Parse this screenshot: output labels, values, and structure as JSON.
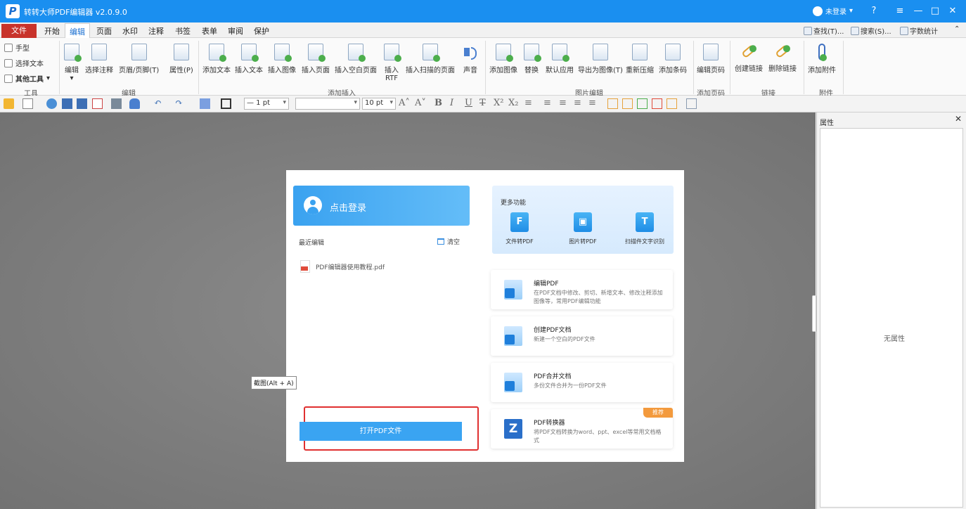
{
  "titlebar": {
    "logo": "P",
    "title": "转转大师PDF编辑器 v2.0.9.0",
    "user_label": "未登录",
    "user_caret": "▾",
    "controls": {
      "help": "?",
      "menu": "≡",
      "minimize": "—",
      "maximize": "□",
      "close": "✕"
    }
  },
  "menubar": {
    "file_tab": "文件",
    "tabs": [
      "开始",
      "编辑",
      "页面",
      "水印",
      "注释",
      "书签",
      "表单",
      "审阅",
      "保护"
    ],
    "active_tab": "编辑",
    "right_tools": [
      "查找(T)...",
      "搜索(S)...",
      "字数统计"
    ],
    "collapse": "⌃"
  },
  "ribbon": {
    "left_tools": [
      "手型",
      "选择文本",
      "其他工具"
    ],
    "buttons": [
      {
        "label": "编辑",
        "sub": "▾"
      },
      {
        "label": "选择注释"
      },
      {
        "label": "页眉/页脚(T)"
      },
      {
        "label": "属性(P)"
      },
      {
        "label": "添加文本"
      },
      {
        "label": "插入文本"
      },
      {
        "label": "插入图像"
      },
      {
        "label": "插入页面"
      },
      {
        "label": "插入空白页面"
      },
      {
        "label": "插入",
        "sub": "RTF"
      },
      {
        "label": "插入扫描的页面"
      },
      {
        "label": "声音"
      },
      {
        "label": "添加图像"
      },
      {
        "label": "替换"
      },
      {
        "label": "默认应用"
      },
      {
        "label": "导出为图像(T)"
      },
      {
        "label": "重新压缩"
      },
      {
        "label": "添加条码"
      },
      {
        "label": "编辑页码"
      },
      {
        "label": "创建链接"
      },
      {
        "label": "删除链接"
      },
      {
        "label": "添加附件"
      }
    ],
    "groups": [
      "工具",
      "编辑",
      "添加插入",
      "图片编辑",
      "添加页码",
      "链接",
      "附件"
    ]
  },
  "toolbar2": {
    "line_width": "— 1 pt",
    "font_name": "",
    "font_size": "10 pt",
    "text_buttons": [
      "A˄",
      "A˅",
      "B",
      "I",
      "U",
      "T",
      "X²",
      "X₂"
    ]
  },
  "start_panel": {
    "login_label": "点击登录",
    "recent_label": "最近编辑",
    "clear_label": "清空",
    "recent_files": [
      "PDF编辑器使用教程.pdf"
    ],
    "open_button": "打开PDF文件",
    "more_title": "更多功能",
    "features": [
      {
        "label": "文件转PDF",
        "glyph": "F"
      },
      {
        "label": "图片转PDF",
        "glyph": "▣"
      },
      {
        "label": "扫描件文字识别",
        "glyph": "T"
      }
    ],
    "cards": [
      {
        "title": "编辑PDF",
        "desc": "在PDF文档中修改、剪切、新增文本、修改注释添加图像等，常用PDF编辑功能"
      },
      {
        "title": "创建PDF文档",
        "desc": "新建一个空白的PDF文件"
      },
      {
        "title": "PDF合并文档",
        "desc": "多份文件合并为一份PDF文件"
      },
      {
        "title": "PDF转换器",
        "desc": "将PDF文档转换为word、ppt、excel等常用文档格式",
        "badge": "推荐"
      }
    ]
  },
  "tooltip": "截图(Alt + A)",
  "properties_panel": {
    "title": "属性",
    "close": "✕",
    "empty": "无属性"
  }
}
